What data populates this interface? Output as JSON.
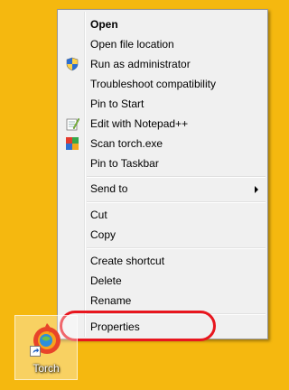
{
  "desktop": {
    "background_color": "#f5b80f",
    "shortcut": {
      "label": "Torch",
      "icon": "torch-icon"
    }
  },
  "context_menu": {
    "items": [
      {
        "label": "Open",
        "bold": true,
        "icon": null
      },
      {
        "label": "Open file location",
        "icon": null
      },
      {
        "label": "Run as administrator",
        "icon": "uac-shield-icon"
      },
      {
        "label": "Troubleshoot compatibility",
        "icon": null
      },
      {
        "label": "Pin to Start",
        "icon": null
      },
      {
        "label": "Edit with Notepad++",
        "icon": "notepadpp-icon"
      },
      {
        "label": "Scan torch.exe",
        "icon": "antivirus-icon"
      },
      {
        "label": "Pin to Taskbar",
        "icon": null
      },
      {
        "label": "Send to",
        "submenu": true,
        "icon": "submenu-arrow-icon"
      },
      {
        "label": "Cut",
        "icon": null
      },
      {
        "label": "Copy",
        "icon": null
      },
      {
        "label": "Create shortcut",
        "icon": null
      },
      {
        "label": "Delete",
        "icon": null
      },
      {
        "label": "Rename",
        "icon": null
      },
      {
        "label": "Properties",
        "icon": null,
        "highlighted": true
      }
    ]
  },
  "annotation": {
    "highlight_color": "#e8161e"
  }
}
